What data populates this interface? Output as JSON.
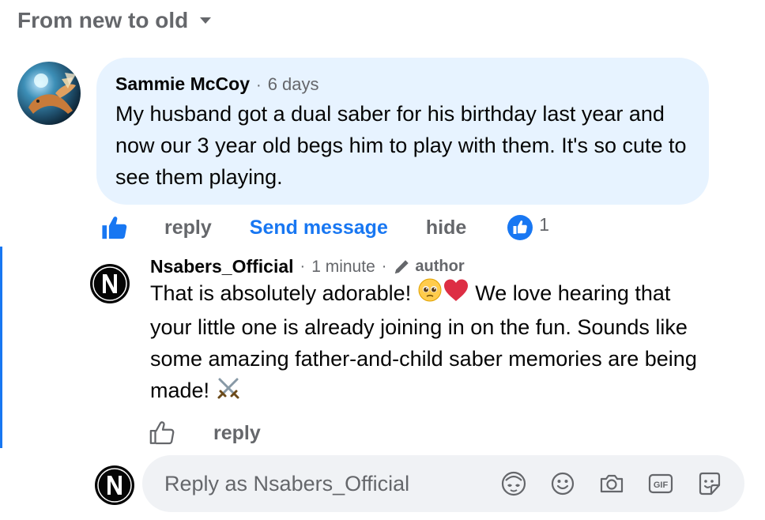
{
  "sort": {
    "label": "From new to old"
  },
  "comment": {
    "author": "Sammie McCoy",
    "separator": "·",
    "time": "6 days",
    "text": "My husband got a dual saber for his birthday last year and now our 3 year old begs him to play with them. It's so cute to see them playing.",
    "actions": {
      "reply": "reply",
      "send_message": "Send message",
      "hide": "hide"
    },
    "like_count": "1"
  },
  "reply": {
    "author": "Nsabers_Official",
    "separator": "·",
    "time": "1 minute",
    "badge": "author",
    "text_part1": "That is absolutely adorable!",
    "text_part2": "We love hearing that your little one is already joining in on the fun. Sounds like some amazing father-and-child saber memories are being made!",
    "actions": {
      "reply": "reply"
    }
  },
  "composer": {
    "placeholder": "Reply as Nsabers_Official"
  },
  "colors": {
    "accent": "#1877f2",
    "bubble": "#e7f3ff",
    "muted": "#65676b",
    "composer_bg": "#f0f2f5"
  },
  "icons": [
    "chevron-down-icon",
    "like-icon",
    "like-badge-icon",
    "pencil-icon",
    "pleading-face-emoji",
    "heart-emoji",
    "crossed-swords-emoji",
    "avatar-sticker-icon",
    "emoji-icon",
    "camera-icon",
    "gif-icon",
    "sticker-icon"
  ]
}
